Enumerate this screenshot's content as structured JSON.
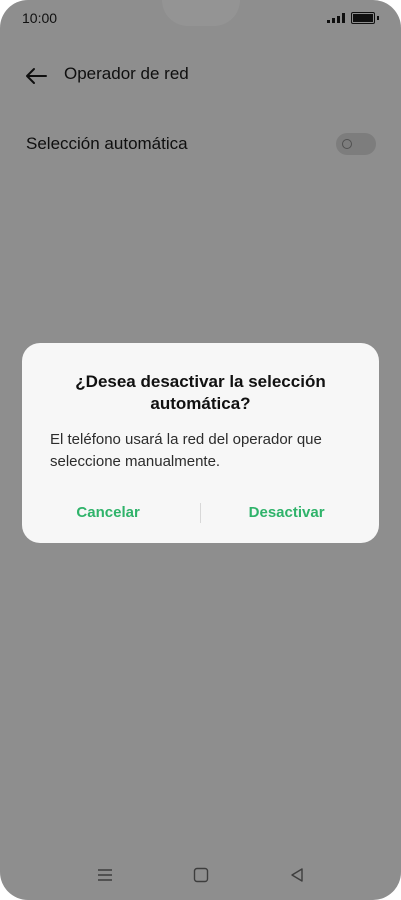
{
  "status": {
    "time": "10:00"
  },
  "header": {
    "title": "Operador de red"
  },
  "setting": {
    "label": "Selección automática",
    "toggle_state": "off"
  },
  "dialog": {
    "title": "¿Desea desactivar la selección automática?",
    "message": "El teléfono usará la red del operador que seleccione manualmente.",
    "cancel_label": "Cancelar",
    "confirm_label": "Desactivar"
  },
  "colors": {
    "accent": "#2fb36a",
    "scrim": "rgba(0,0,0,0.42)"
  },
  "icons": {
    "back": "arrow-left",
    "recents": "menu",
    "home": "square",
    "back_nav": "triangle-left"
  }
}
